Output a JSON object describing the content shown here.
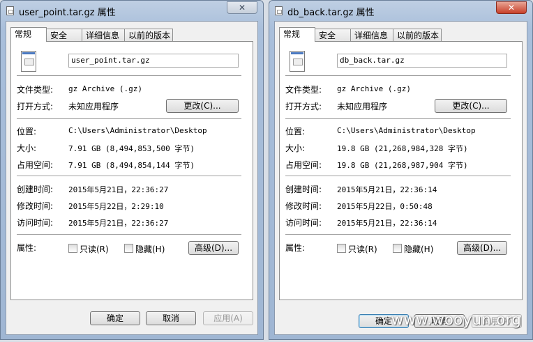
{
  "windows": [
    {
      "title": "user_point.tar.gz 属性",
      "close_label": "✕",
      "tabs": [
        "常规",
        "安全",
        "详细信息",
        "以前的版本"
      ],
      "file_name": "user_point.tar.gz",
      "file_type_label": "文件类型:",
      "file_type_value": "gz Archive (.gz)",
      "opens_with_label": "打开方式:",
      "opens_with_value": "未知应用程序",
      "change_button": "更改(C)...",
      "location_label": "位置:",
      "location_value": "C:\\Users\\Administrator\\Desktop",
      "size_label": "大小:",
      "size_value": "7.91 GB (8,494,853,500 字节)",
      "size_on_disk_label": "占用空间:",
      "size_on_disk_value": "7.91 GB (8,494,854,144 字节)",
      "created_label": "创建时间:",
      "created_value": "2015年5月21日，22:36:27",
      "modified_label": "修改时间:",
      "modified_value": "2015年5月22日，2:29:10",
      "accessed_label": "访问时间:",
      "accessed_value": "2015年5月21日，22:36:27",
      "attributes_label": "属性:",
      "readonly_label": "只读(R)",
      "hidden_label": "隐藏(H)",
      "advanced_button": "高级(D)...",
      "ok_button": "确定",
      "cancel_button": "取消",
      "apply_button": "应用(A)"
    },
    {
      "title": "db_back.tar.gz 属性",
      "close_label": "✕",
      "tabs": [
        "常规",
        "安全",
        "详细信息",
        "以前的版本"
      ],
      "file_name": "db_back.tar.gz",
      "file_type_label": "文件类型:",
      "file_type_value": "gz Archive (.gz)",
      "opens_with_label": "打开方式:",
      "opens_with_value": "未知应用程序",
      "change_button": "更改(C)...",
      "location_label": "位置:",
      "location_value": "C:\\Users\\Administrator\\Desktop",
      "size_label": "大小:",
      "size_value": "19.8 GB (21,268,984,328 字节)",
      "size_on_disk_label": "占用空间:",
      "size_on_disk_value": "19.8 GB (21,268,987,904 字节)",
      "created_label": "创建时间:",
      "created_value": "2015年5月21日，22:36:14",
      "modified_label": "修改时间:",
      "modified_value": "2015年5月22日，0:50:48",
      "accessed_label": "访问时间:",
      "accessed_value": "2015年5月21日，22:36:14",
      "attributes_label": "属性:",
      "readonly_label": "只读(R)",
      "hidden_label": "隐藏(H)",
      "advanced_button": "高级(D)...",
      "ok_button": "确定",
      "cancel_button": "取消",
      "apply_button": "应用(A)"
    }
  ],
  "watermark": "www.wooyun.org",
  "icons": {
    "title_icon": "document-icon",
    "file_icon": "archive-file-icon",
    "close": "close-icon"
  }
}
